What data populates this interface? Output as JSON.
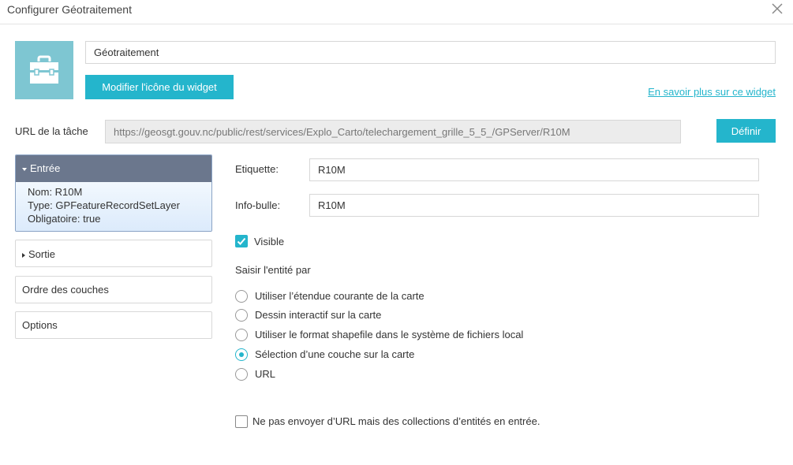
{
  "header": {
    "title": "Configurer Géotraitement",
    "close_icon": "close-icon"
  },
  "widget": {
    "icon": "toolbox-icon",
    "icon_bg": "#7ec6d2",
    "name_value": "Géotraitement",
    "change_icon_label": "Modifier l'icône du widget",
    "learn_more_label": "En savoir plus sur ce widget"
  },
  "task": {
    "url_label": "URL de la tâche",
    "url_value": "https://geosgt.gouv.nc/public/rest/services/Explo_Carto/telechargement_grille_5_5_/GPServer/R10M",
    "define_label": "Définir"
  },
  "sidebar": {
    "entree": {
      "label": "Entrée",
      "nom": "Nom: R10M",
      "type": "Type: GPFeatureRecordSetLayer",
      "obligatoire": "Obligatoire: true"
    },
    "sortie": "Sortie",
    "ordre": "Ordre des couches",
    "options": "Options"
  },
  "form": {
    "etiquette_label": "Etiquette:",
    "etiquette_value": "R10M",
    "infobulle_label": "Info-bulle:",
    "infobulle_value": "R10M",
    "visible_label": "Visible",
    "visible_checked": true,
    "saisir_label": "Saisir l'entité par",
    "options": [
      {
        "label": "Utiliser l’étendue courante de la carte",
        "selected": false
      },
      {
        "label": "Dessin interactif sur la carte",
        "selected": false
      },
      {
        "label": "Utiliser le format shapefile dans le système de fichiers local",
        "selected": false
      },
      {
        "label": "Sélection d’une couche sur la carte",
        "selected": true
      },
      {
        "label": "URL",
        "selected": false
      }
    ],
    "no_url_label": "Ne pas envoyer d’URL mais des collections d’entités en entrée.",
    "no_url_checked": false
  },
  "colors": {
    "accent": "#24b5cc",
    "panel_header": "#6b778d"
  }
}
